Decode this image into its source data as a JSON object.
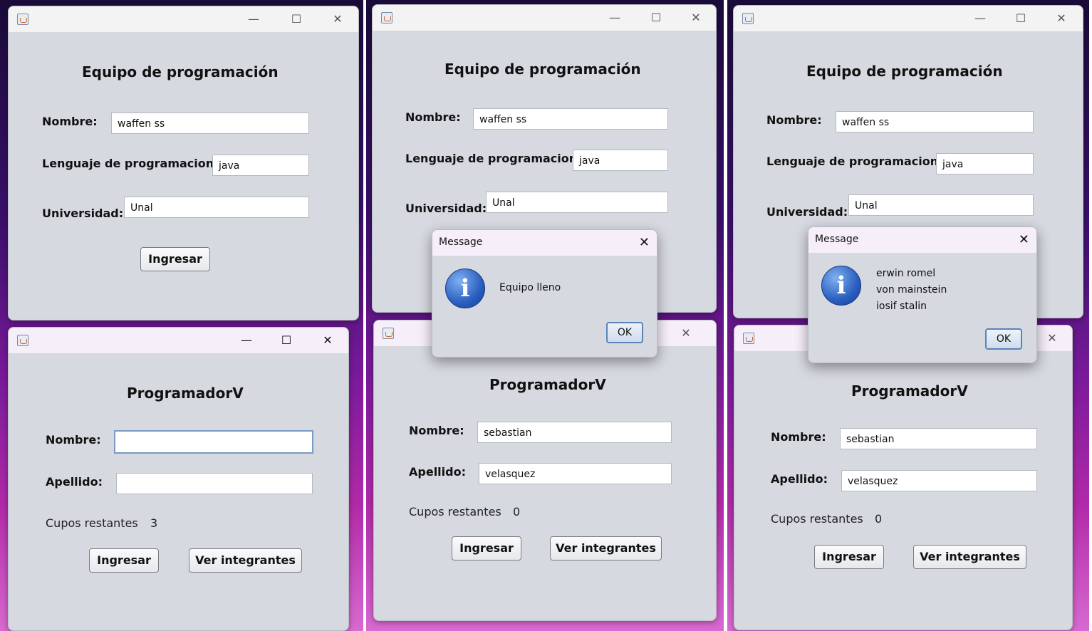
{
  "team_window": {
    "title": "Equipo de programación",
    "nombre_label": "Nombre:",
    "nombre_value": "waffen ss",
    "lenguaje_label": "Lenguaje de programacion:",
    "lenguaje_value": "java",
    "universidad_label": "Universidad:",
    "universidad_value": "Unal",
    "ingresar_label": "Ingresar"
  },
  "programmer_window": {
    "title": "ProgramadorV",
    "nombre_label": "Nombre:",
    "apellido_label": "Apellido:",
    "cupos_label": "Cupos restantes",
    "ingresar_label": "Ingresar",
    "ver_label": "Ver integrantes"
  },
  "screens": [
    {
      "programmer": {
        "nombre_value": "",
        "apellido_value": "",
        "cupos_value": "3"
      }
    },
    {
      "programmer": {
        "nombre_value": "sebastian",
        "apellido_value": "velasquez",
        "cupos_value": "0"
      },
      "dialog": {
        "title": "Message",
        "message": "Equipo lleno",
        "ok_label": "OK"
      }
    },
    {
      "programmer": {
        "nombre_value": "sebastian",
        "apellido_value": "velasquez",
        "cupos_value": "0"
      },
      "dialog": {
        "title": "Message",
        "lines": [
          "erwin  romel",
          "von mainstein",
          "iosif stalin"
        ],
        "ok_label": "OK"
      }
    }
  ],
  "icons": {
    "window_controls": [
      "minimize-icon",
      "maximize-icon",
      "close-icon"
    ],
    "dialog_icon": "info-icon"
  }
}
